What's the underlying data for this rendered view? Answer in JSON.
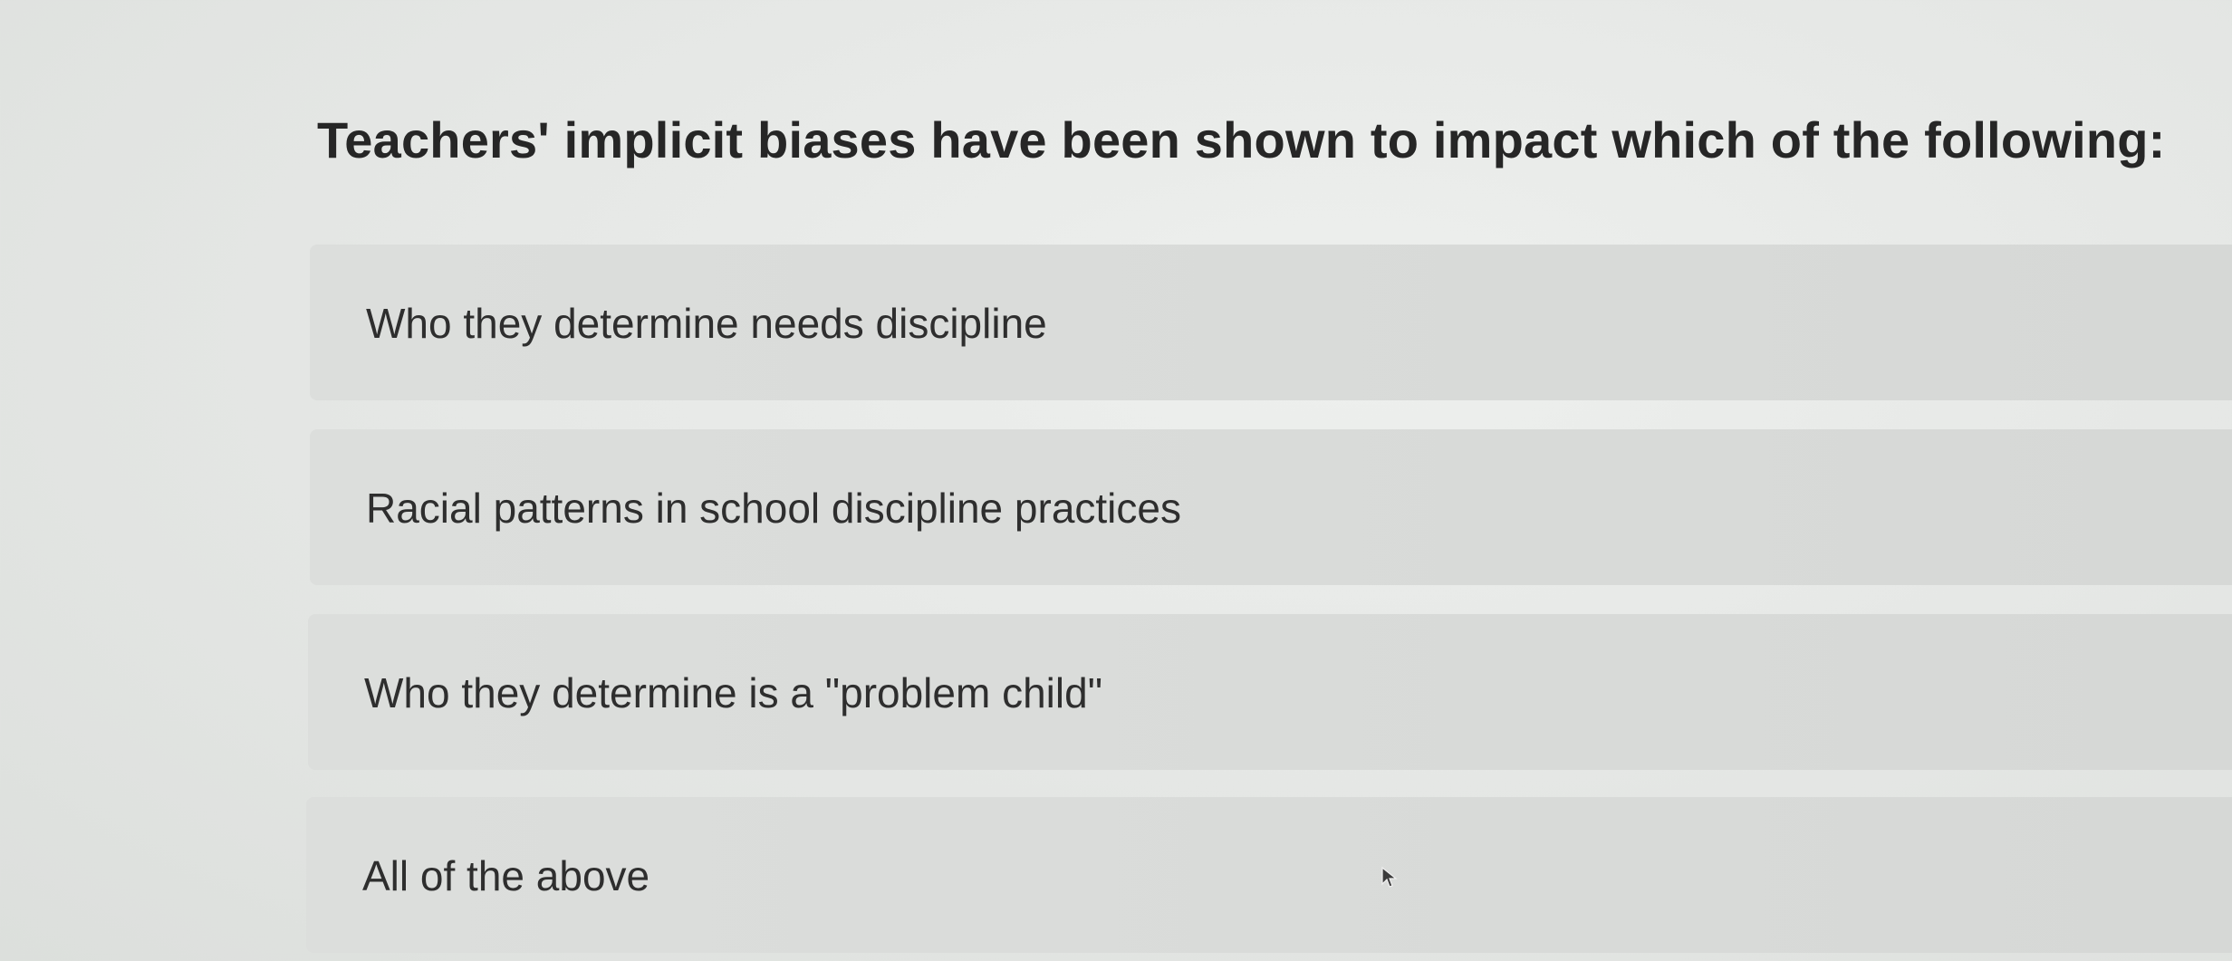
{
  "question": {
    "text": "Teachers' implicit biases have been shown to impact which of the following:"
  },
  "options": [
    {
      "label": "Who they determine needs discipline"
    },
    {
      "label": "Racial patterns in school discipline practices"
    },
    {
      "label": "Who they determine is a \"problem child\""
    },
    {
      "label": "All of the above"
    }
  ],
  "cursor": {
    "icon": "mouse-pointer-icon"
  }
}
